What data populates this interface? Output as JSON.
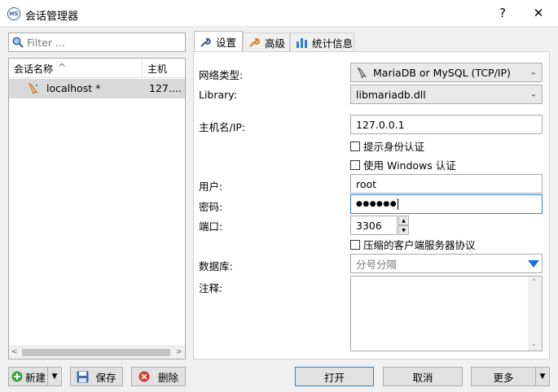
{
  "window": {
    "title": "会话管理器",
    "help_glyph": "?",
    "close_glyph": "✕",
    "app_icon_text": "HS"
  },
  "filter": {
    "placeholder": "Filter ..."
  },
  "session_list": {
    "columns": [
      "会话名称",
      "主机"
    ],
    "sort_glyph": "^",
    "rows": [
      {
        "name": "localhost *",
        "host": "127...."
      }
    ]
  },
  "bottom_left_buttons": {
    "new": "新建",
    "save": "保存",
    "delete": "删除"
  },
  "tabs": [
    "设置",
    "高级",
    "统计信息"
  ],
  "form": {
    "network_type_label": "网络类型:",
    "network_type_value": "MariaDB or MySQL (TCP/IP)",
    "library_label": "Library:",
    "library_value": "libmariadb.dll",
    "host_label": "主机名/IP:",
    "host_value": "127.0.0.1",
    "prompt_auth_label": "提示身份认证",
    "windows_auth_label": "使用 Windows 认证",
    "user_label": "用户:",
    "user_value": "root",
    "password_label": "密码:",
    "password_value": "●●●●●●",
    "port_label": "端口:",
    "port_value": "3306",
    "compress_label": "压缩的客户端服务器协议",
    "database_label": "数据库:",
    "database_placeholder": "分号分隔",
    "comment_label": "注释:"
  },
  "bottom_right_buttons": {
    "open": "打开",
    "cancel": "取消",
    "more": "更多"
  },
  "colors": {
    "accent": "#2f7fd2",
    "selection": "#d9d9d9",
    "dropdown_arrow": "#1e6fd9"
  }
}
